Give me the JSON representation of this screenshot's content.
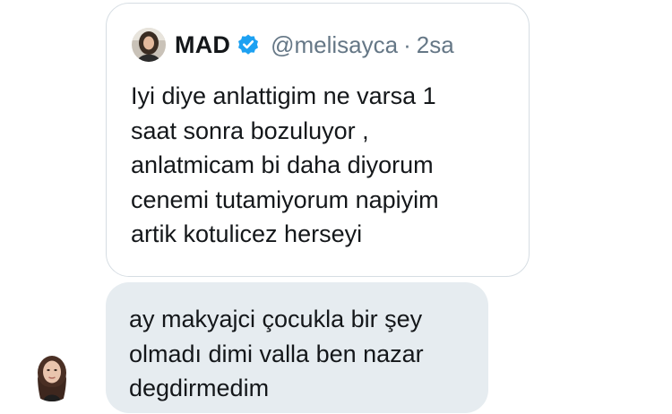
{
  "quoted_tweet": {
    "display_name": "MAD",
    "verified": true,
    "handle": "@melisayca",
    "separator": "·",
    "time": "2sa",
    "text": "Iyi diye anlattigim ne varsa 1\nsaat sonra bozuluyor ,\nanlatmicam bi daha diyorum\ncenemi tutamiyorum napiyim\nartik kotulicez herseyi",
    "avatar_icon": "profile-photo-icon"
  },
  "message": {
    "text": "ay makyajci çocukla bir şey\nolmadı dimi valla ben nazar\ndegdirmedim",
    "sender_avatar_icon": "profile-photo-icon"
  },
  "colors": {
    "bubble_bg": "#e6ecf0",
    "card_border": "#d6dde3",
    "text": "#14171a",
    "muted": "#657786",
    "verified_blue": "#1da1f2"
  }
}
